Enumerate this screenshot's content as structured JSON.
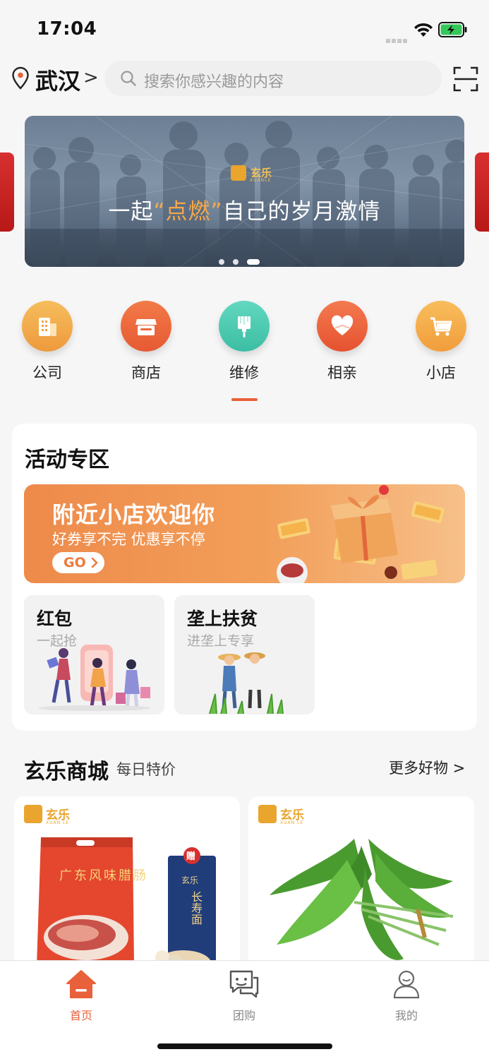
{
  "status": {
    "time": "17:04"
  },
  "header": {
    "city": "武汉",
    "city_chevron": ">",
    "search_placeholder": "搜索你感兴趣的内容"
  },
  "banner": {
    "logo_text": "玄乐",
    "logo_sub": "XUANLE",
    "slogan_pre": "一起",
    "slogan_highlight": "“点燃”",
    "slogan_post": "自己的岁月激情",
    "active_dot": 2,
    "dot_count": 3
  },
  "categories": [
    {
      "label": "公司",
      "icon": "building-icon",
      "color": "#f2a94a"
    },
    {
      "label": "商店",
      "icon": "store-icon",
      "color": "#ec6a3e"
    },
    {
      "label": "维修",
      "icon": "repair-brush-icon",
      "color": "#4cc9b0"
    },
    {
      "label": "相亲",
      "icon": "heart-icon",
      "color": "#ee6440"
    },
    {
      "label": "小店",
      "icon": "cart-icon",
      "color": "#f4a848"
    }
  ],
  "active_category_indicator": "维修",
  "activity": {
    "title": "活动专区",
    "promo": {
      "title": "附近小店欢迎你",
      "subtitle": "好券享不完 优惠享不停",
      "button": "GO"
    },
    "cards": [
      {
        "title": "红包",
        "subtitle": "一起抢"
      },
      {
        "title": "垄上扶贫",
        "subtitle": "进垄上专享"
      }
    ]
  },
  "mall": {
    "title": "玄乐商城",
    "subtitle": "每日特价",
    "more": "更多好物 >",
    "brand_text": "玄乐",
    "brand_sub": "XUAN LE",
    "products": [
      {
        "package_text": "广东风味腊肠",
        "gift_badge": "赠",
        "noodle_text": "长寿面",
        "noodle_brand": "玄乐"
      },
      {
        "name": "vegetable"
      }
    ]
  },
  "tabbar": {
    "tabs": [
      {
        "label": "首页",
        "icon": "home-icon",
        "active": true
      },
      {
        "label": "团购",
        "icon": "chat-bubbles-icon",
        "active": false
      },
      {
        "label": "我的",
        "icon": "user-icon",
        "active": false
      }
    ]
  },
  "colors": {
    "accent": "#e8613a",
    "brand_gold": "#e9a52e"
  }
}
